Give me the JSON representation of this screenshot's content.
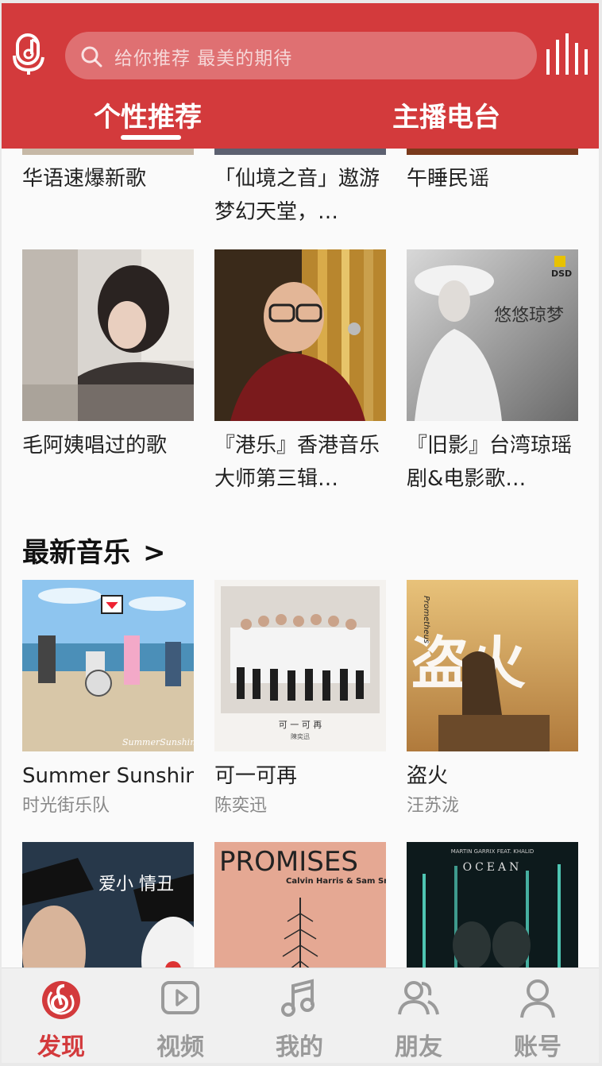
{
  "header": {
    "search_placeholder": "给你推荐  最美的期待",
    "tabs": [
      {
        "label": "个性推荐",
        "active": true
      },
      {
        "label": "主播电台",
        "active": false
      }
    ],
    "accent_color": "#d33a3c"
  },
  "playlists_row1": [
    {
      "title": "华语速爆新歌"
    },
    {
      "title": "「仙境之音」遨游梦幻天堂，…"
    },
    {
      "title": "午睡民谣"
    }
  ],
  "playlists_row2": [
    {
      "title": "毛阿姨唱过的歌"
    },
    {
      "title": "『港乐』香港音乐大师第三辑…"
    },
    {
      "title": "『旧影』台湾琼瑶剧&电影歌…"
    }
  ],
  "latest_music": {
    "title": "最新音乐",
    "arrow": ">",
    "items": [
      {
        "title": "Summer Sunshin",
        "artist": "时光街乐队",
        "cover_text": "SummerSunshine"
      },
      {
        "title": "可一可再",
        "artist": "陈奕迅",
        "cover_text": "可 一 可 再",
        "cover_subtext": "陳奕迅"
      },
      {
        "title": "盗火",
        "artist": "汪苏泷",
        "cover_text": "盗火",
        "cover_side": "Prometheus"
      }
    ],
    "row2_covers": [
      {
        "cover_text": "爱小 情丑"
      },
      {
        "cover_text": "PROMISES",
        "cover_subtext": "Calvin Harris & Sam Smith"
      },
      {
        "cover_text": "OCEAN",
        "cover_subtext": "MARTIN GARRIX FEAT. KHALID"
      }
    ]
  },
  "cover_badges": {
    "dsd": "DSD",
    "album_title_4": "悠悠琼梦"
  },
  "bottom_nav": [
    {
      "label": "发现",
      "icon": "netease-music-icon",
      "active": true
    },
    {
      "label": "视频",
      "icon": "video-icon",
      "active": false
    },
    {
      "label": "我的",
      "icon": "music-note-icon",
      "active": false
    },
    {
      "label": "朋友",
      "icon": "friends-icon",
      "active": false
    },
    {
      "label": "账号",
      "icon": "account-icon",
      "active": false
    }
  ]
}
